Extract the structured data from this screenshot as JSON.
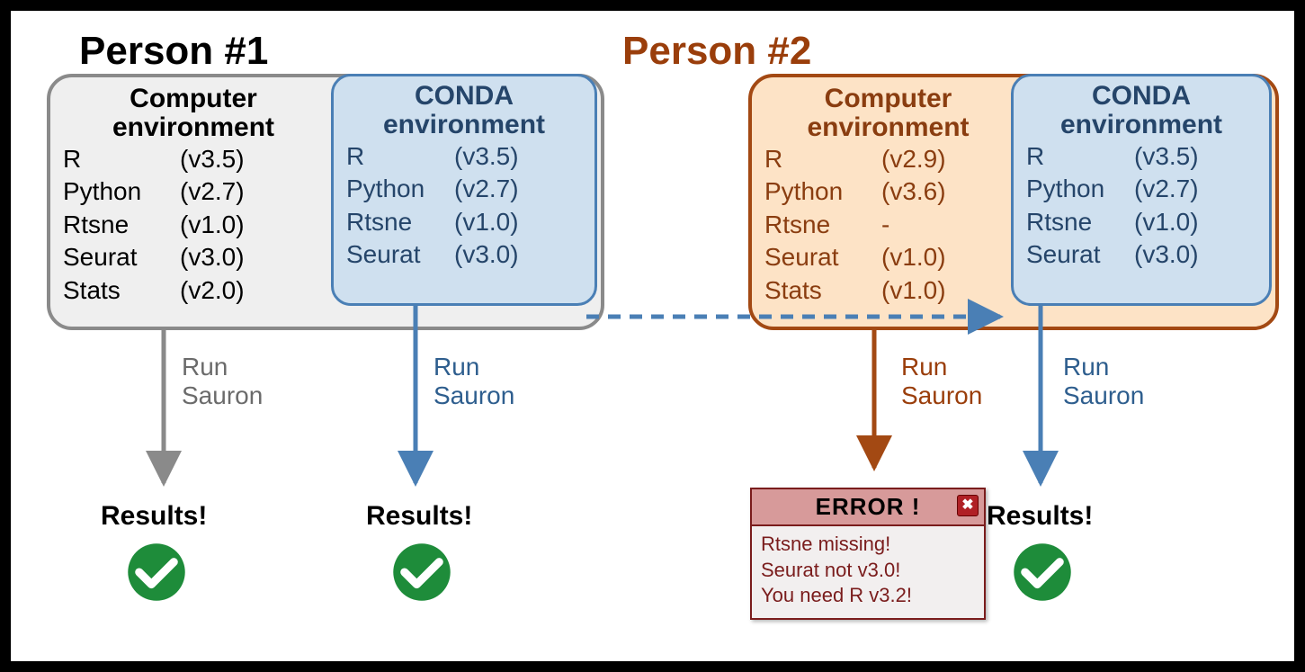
{
  "person1": {
    "title": "Person #1",
    "computer_env": {
      "title": "Computer\nenvironment",
      "pkgs": [
        {
          "name": "R",
          "ver": "(v3.5)"
        },
        {
          "name": "Python",
          "ver": "(v2.7)"
        },
        {
          "name": "Rtsne",
          "ver": "(v1.0)"
        },
        {
          "name": "Seurat",
          "ver": "(v3.0)"
        },
        {
          "name": "Stats",
          "ver": "(v2.0)"
        }
      ]
    },
    "conda_env": {
      "title": "CONDA\nenvironment",
      "pkgs": [
        {
          "name": "R",
          "ver": "(v3.5)"
        },
        {
          "name": "Python",
          "ver": "(v2.7)"
        },
        {
          "name": "Rtsne",
          "ver": "(v1.0)"
        },
        {
          "name": "Seurat",
          "ver": "(v3.0)"
        }
      ]
    },
    "arrows": {
      "computer_label": "Run\nSauron",
      "conda_label": "Run\nSauron",
      "computer_result": "Results!",
      "conda_result": "Results!"
    }
  },
  "person2": {
    "title": "Person #2",
    "computer_env": {
      "title": "Computer\nenvironment",
      "pkgs": [
        {
          "name": "R",
          "ver": "(v2.9)"
        },
        {
          "name": "Python",
          "ver": "(v3.6)"
        },
        {
          "name": "Rtsne",
          "ver": "-"
        },
        {
          "name": "Seurat",
          "ver": "(v1.0)"
        },
        {
          "name": "Stats",
          "ver": "(v1.0)"
        }
      ]
    },
    "conda_env": {
      "title": "CONDA\nenvironment",
      "pkgs": [
        {
          "name": "R",
          "ver": "(v3.5)"
        },
        {
          "name": "Python",
          "ver": "(v2.7)"
        },
        {
          "name": "Rtsne",
          "ver": "(v1.0)"
        },
        {
          "name": "Seurat",
          "ver": "(v3.0)"
        }
      ]
    },
    "arrows": {
      "computer_label": "Run\nSauron",
      "conda_label": "Run\nSauron",
      "conda_result": "Results!"
    },
    "error": {
      "title": "ERROR !",
      "lines": [
        "Rtsne missing!",
        "Seurat not v3.0!",
        "You need R v3.2!"
      ]
    }
  },
  "colors": {
    "p1_border": "#8a8a8a",
    "p2_border": "#a34913",
    "conda_border": "#4a7fb5",
    "success": "#1e8c3a",
    "error_border": "#7a1c1c"
  }
}
